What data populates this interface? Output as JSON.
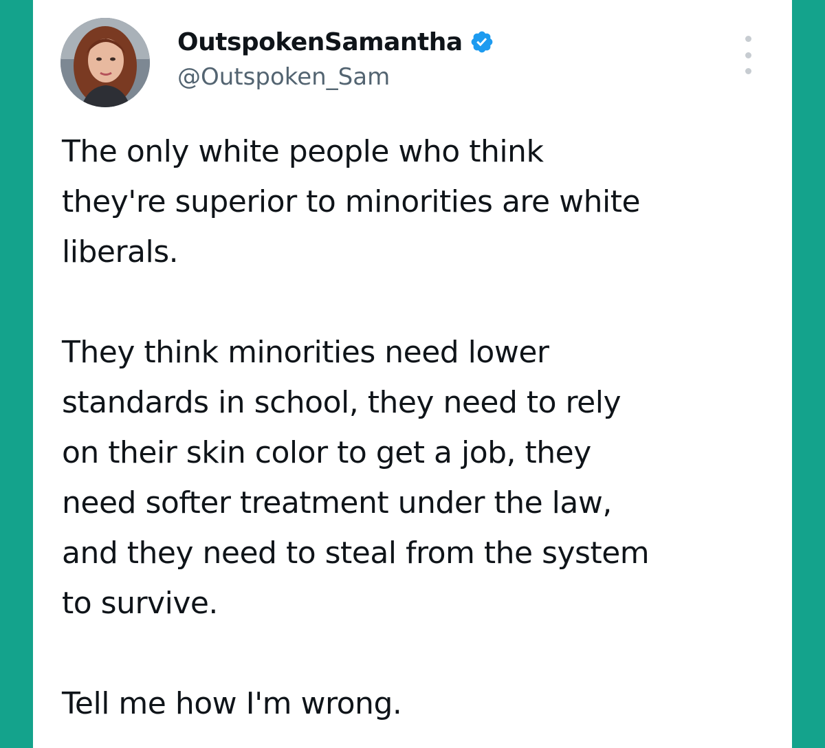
{
  "tweet": {
    "author": {
      "display_name": "OutspokenSamantha",
      "handle": "@Outspoken_Sam",
      "verified": true,
      "verified_color": "#1d9bf0"
    },
    "paragraphs": [
      "The only white people who think\nthey're superior to minorities are white\nliberals.",
      "They think minorities need lower\nstandards in school, they need to rely\non their skin color to get a job, they\nneed softer treatment under the law,\nand they need to steal from the system\nto survive.",
      "Tell me how I'm wrong."
    ]
  },
  "colors": {
    "background": "#14a38c",
    "card": "#ffffff",
    "text_primary": "#0f1419",
    "text_secondary": "#536471"
  },
  "icons": {
    "avatar": "profile-photo",
    "verified": "verified-badge-icon",
    "more": "more-options-icon"
  }
}
